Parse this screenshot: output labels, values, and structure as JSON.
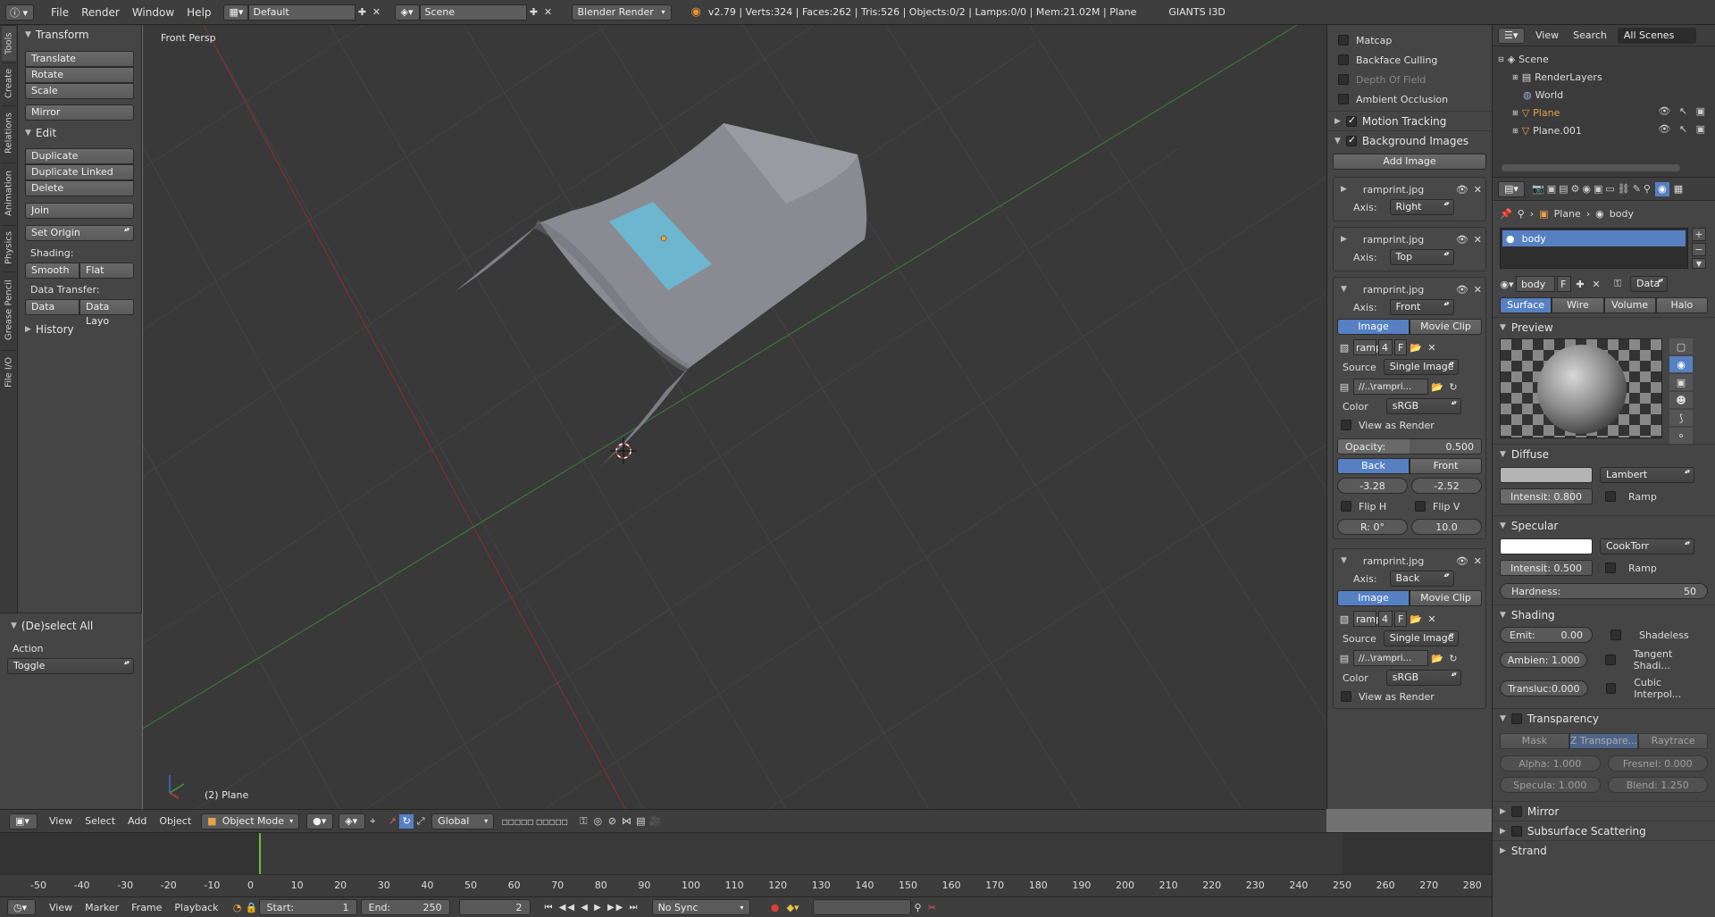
{
  "topbar": {
    "menus": [
      "File",
      "Render",
      "Window",
      "Help"
    ],
    "layout": "Default",
    "scene": "Scene",
    "engine": "Blender Render",
    "stats": "v2.79 | Verts:324 | Faces:262 | Tris:526 | Objects:0/2 | Lamps:0/0 | Mem:21.02M | Plane",
    "extra": "GIANTS I3D"
  },
  "tabs": [
    "Tools",
    "Create",
    "Relations",
    "Animation",
    "Physics",
    "Grease Pencil",
    "File I/O"
  ],
  "toolshelf": {
    "transform_title": "Transform",
    "translate": "Translate",
    "rotate": "Rotate",
    "scale": "Scale",
    "mirror": "Mirror",
    "edit_title": "Edit",
    "duplicate": "Duplicate",
    "duplicate_linked": "Duplicate Linked",
    "delete": "Delete",
    "join": "Join",
    "set_origin": "Set Origin",
    "shading_label": "Shading:",
    "smooth": "Smooth",
    "flat": "Flat",
    "data_transfer_label": "Data Transfer:",
    "data": "Data",
    "data_layo": "Data Layo",
    "history_title": "History"
  },
  "operator": {
    "title": "(De)select All",
    "action_label": "Action",
    "action_value": "Toggle"
  },
  "viewport": {
    "view_name": "Front Persp",
    "object_label": "(2) Plane"
  },
  "vp_header": {
    "menus": [
      "View",
      "Select",
      "Add",
      "Object"
    ],
    "mode": "Object Mode",
    "orientation": "Global"
  },
  "npanel": {
    "matcap": "Matcap",
    "backface": "Backface Culling",
    "dof": "Depth Of Field",
    "ao": "Ambient Occlusion",
    "motion_tracking": "Motion Tracking",
    "bg_images": "Background Images",
    "add_image": "Add Image",
    "images": [
      {
        "name": "ramprint.jpg",
        "axis": "Right"
      },
      {
        "name": "ramprint.jpg",
        "axis": "Top"
      },
      {
        "name": "ramprint.jpg",
        "axis": "Front",
        "image_tab": "Image",
        "movie_tab": "Movie Clip",
        "img_field": "ramp",
        "users": "4",
        "f": "F",
        "source_label": "Source",
        "source": "Single Image",
        "path": "//..\\rampri...",
        "color_label": "Color",
        "color": "sRGB",
        "view_as_render": "View as Render",
        "opacity_label": "Opacity:",
        "opacity": "0.500",
        "back": "Back",
        "front": "Front",
        "x": "-3.28",
        "y": "-2.52",
        "fliph": "Flip H",
        "flipv": "Flip V",
        "rot": "R: 0°",
        "size": "10.0"
      },
      {
        "name": "ramprint.jpg",
        "axis": "Back",
        "image_tab": "Image",
        "movie_tab": "Movie Clip",
        "img_field": "ramp",
        "users": "4",
        "f": "F",
        "source_label": "Source",
        "source": "Single Image",
        "path": "//..\\rampri...",
        "color_label": "Color",
        "color": "sRGB",
        "view_as_render": "View as Render"
      }
    ]
  },
  "outliner": {
    "view": "View",
    "search": "Search",
    "filter": "All Scenes",
    "items": [
      "Scene",
      "RenderLayers",
      "World",
      "Plane",
      "Plane.001"
    ]
  },
  "props": {
    "crumb_obj": "Plane",
    "crumb_mat": "body",
    "slot": "body",
    "mat_field": "body",
    "f": "F",
    "data": "Data",
    "tabs": [
      "Surface",
      "Wire",
      "Volume",
      "Halo"
    ],
    "preview": "Preview",
    "diffuse": "Diffuse",
    "diffuse_shader": "Lambert",
    "diffuse_int": "Intensit: 0.800",
    "ramp": "Ramp",
    "specular": "Specular",
    "spec_shader": "CookTorr",
    "spec_int": "Intensit: 0.500",
    "hardness_label": "Hardness:",
    "hardness": "50",
    "shading": "Shading",
    "emit": "Emit:",
    "emit_v": "0.00",
    "ambient": "Ambien: 1.000",
    "transluc": "Transluc:0.000",
    "shadeless": "Shadeless",
    "tangent": "Tangent Shadi...",
    "cubic": "Cubic Interpol...",
    "transparency": "Transparency",
    "mask": "Mask",
    "ztrans": "Z Transpare...",
    "raytrace": "Raytrace",
    "alpha": "Alpha: 1.000",
    "fresnel": "Fresnel: 0.000",
    "specula": "Specula: 1.000",
    "blend": "Blend: 1.250",
    "mirror": "Mirror",
    "sss": "Subsurface Scattering",
    "strand": "Strand"
  },
  "timeline": {
    "ticks": [
      "-50",
      "-40",
      "-30",
      "-20",
      "-10",
      "0",
      "10",
      "20",
      "30",
      "40",
      "50",
      "60",
      "70",
      "80",
      "90",
      "100",
      "110",
      "120",
      "130",
      "140",
      "150",
      "160",
      "170",
      "180",
      "190",
      "200",
      "210",
      "220",
      "230",
      "240",
      "250",
      "260",
      "270",
      "280"
    ]
  },
  "tl_bottom": {
    "menus": [
      "View",
      "Marker",
      "Frame",
      "Playback"
    ],
    "start": "Start:",
    "start_v": "1",
    "end": "End:",
    "end_v": "250",
    "current": "2",
    "sync": "No Sync"
  }
}
